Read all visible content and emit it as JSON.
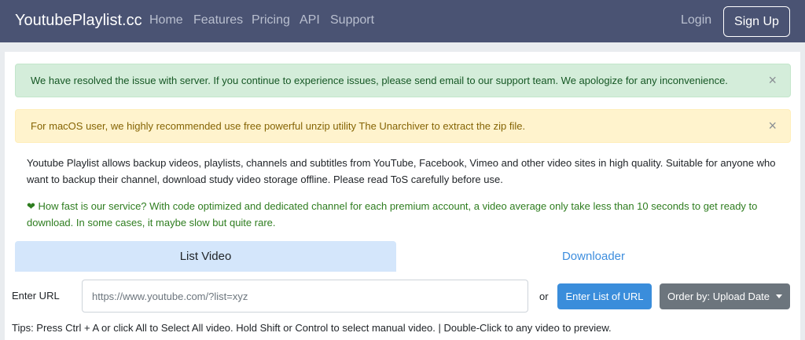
{
  "navbar": {
    "brand": "YoutubePlaylist.cc",
    "links": [
      "Home",
      "Features",
      "Pricing",
      "API",
      "Support"
    ],
    "login": "Login",
    "signup": "Sign Up"
  },
  "alerts": {
    "success": "We have resolved the issue with server. If you continue to experience issues, please send email to our support team. We apologize for any inconvenience.",
    "warning": "For macOS user, we highly recommended use free powerful unzip utility The Unarchiver to extract the zip file.",
    "close_glyph": "×"
  },
  "intro": {
    "description": "Youtube Playlist allows backup videos, playlists, channels and subtitles from YouTube, Facebook, Vimeo and other video sites in high quality. Suitable for anyone who want to backup their channel, download study video storage offline. Please read ToS carefully before use.",
    "heart": "❤",
    "speed_note": "How fast is our service? With code optimized and dedicated channel for each premium account, a video average only take less than 10 seconds to get ready to download. In some cases, it maybe slow but quite rare."
  },
  "tabs": {
    "list_video": "List Video",
    "downloader": "Downloader"
  },
  "form": {
    "url_label": "Enter URL",
    "url_placeholder": "https://www.youtube.com/?list=xyz",
    "or": "or",
    "enter_list_button": "Enter List of URL",
    "order_button": "Order by: Upload Date"
  },
  "tips": "Tips: Press Ctrl + A or click All to Select All video. Hold Shift or Control to select manual video. | Double-Click to any video to preview.",
  "colors": {
    "navbar": "#4a5373",
    "success_bg": "#d4edda",
    "warning_bg": "#fff3cd",
    "primary": "#3a8ddb",
    "secondary": "#6c757d"
  }
}
